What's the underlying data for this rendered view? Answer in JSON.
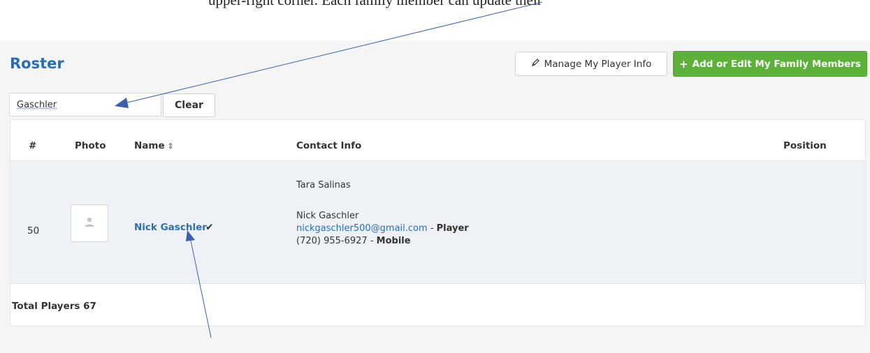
{
  "caption": "upper-right corner. Each family member can update their own player info",
  "roster": {
    "title": "Roster",
    "manage_button": "Manage My Player Info",
    "add_button": "Add or Edit My Family Members",
    "search": {
      "value": "Gaschler",
      "placeholder": ""
    },
    "clear_button": "Clear",
    "columns": {
      "num": "#",
      "photo": "Photo",
      "name": "Name",
      "contact": "Contact Info",
      "position": "Position"
    },
    "player": {
      "number": "50",
      "name": "Nick Gaschler",
      "contacts": {
        "parent": "Tara Salinas",
        "name": "Nick Gaschler",
        "email": "nickgaschler500@gmail.com",
        "email_role": "Player",
        "phone": "(720) 955-6927",
        "phone_type": "Mobile"
      }
    },
    "total": "Total Players 67"
  },
  "colors": {
    "accent": "#2a6db0",
    "green": "#5cb238",
    "row_bg": "#eef2f6",
    "arrow": "#3b5fb0"
  }
}
